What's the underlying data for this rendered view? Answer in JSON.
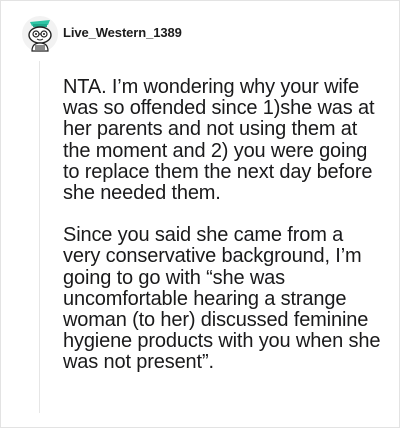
{
  "post": {
    "author": "Live_Western_1389",
    "avatar_icon": "snoo-avatar-icon",
    "paragraphs": [
      "NTA. I’m wondering why your wife was so offended since 1)she was at her parents and not using them at the moment and 2) you were going to replace them the next day before she needed them.",
      "Since you said she came from a very conservative background, I’m going to go with “she was uncomfortable hearing a strange woman (to her) discussed feminine hygiene products with you when she was not present”."
    ]
  }
}
